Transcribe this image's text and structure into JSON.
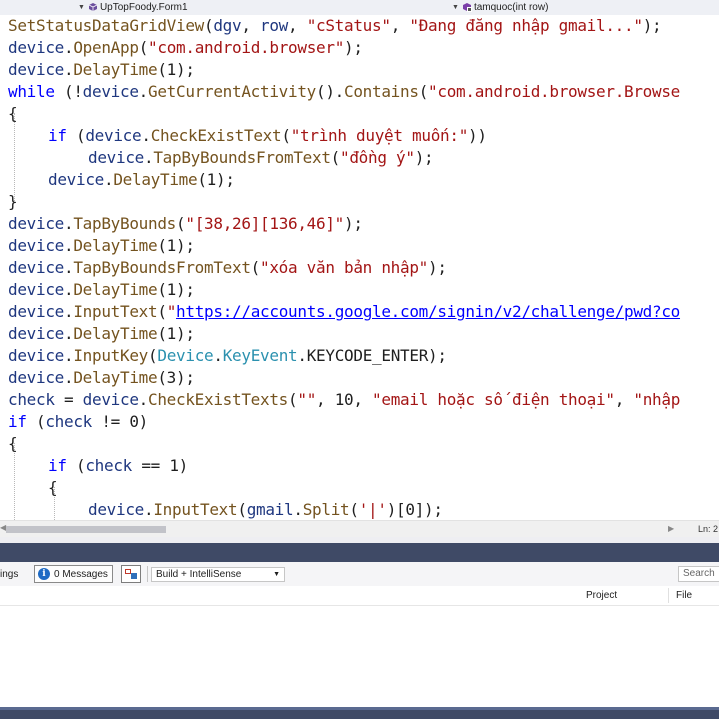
{
  "navbar": {
    "class_dropdown": "UpTopFoody.Form1",
    "member_dropdown": "tamquoc(int row)"
  },
  "editor": {
    "lines": [
      {
        "indent": 0,
        "tokens": [
          {
            "t": "SetStatusDataGridView",
            "c": "fn"
          },
          {
            "t": "(",
            "c": "plain"
          },
          {
            "t": "dgv",
            "c": "id"
          },
          {
            "t": ", ",
            "c": "plain"
          },
          {
            "t": "row",
            "c": "id"
          },
          {
            "t": ", ",
            "c": "plain"
          },
          {
            "t": "\"cStatus\"",
            "c": "str"
          },
          {
            "t": ", ",
            "c": "plain"
          },
          {
            "t": "\"Đang đăng nhập gmail...\"",
            "c": "str"
          },
          {
            "t": ");",
            "c": "plain"
          }
        ]
      },
      {
        "indent": 0,
        "tokens": [
          {
            "t": "device",
            "c": "id"
          },
          {
            "t": ".",
            "c": "plain"
          },
          {
            "t": "OpenApp",
            "c": "fn"
          },
          {
            "t": "(",
            "c": "plain"
          },
          {
            "t": "\"com.android.browser\"",
            "c": "str"
          },
          {
            "t": ");",
            "c": "plain"
          }
        ]
      },
      {
        "indent": 0,
        "tokens": [
          {
            "t": "device",
            "c": "id"
          },
          {
            "t": ".",
            "c": "plain"
          },
          {
            "t": "DelayTime",
            "c": "fn"
          },
          {
            "t": "(1);",
            "c": "plain"
          }
        ]
      },
      {
        "indent": 0,
        "tokens": [
          {
            "t": "while",
            "c": "kw"
          },
          {
            "t": " (!",
            "c": "plain"
          },
          {
            "t": "device",
            "c": "id"
          },
          {
            "t": ".",
            "c": "plain"
          },
          {
            "t": "GetCurrentActivity",
            "c": "fn"
          },
          {
            "t": "().",
            "c": "plain"
          },
          {
            "t": "Contains",
            "c": "fn"
          },
          {
            "t": "(",
            "c": "plain"
          },
          {
            "t": "\"com.android.browser.Browse",
            "c": "str"
          }
        ]
      },
      {
        "indent": 0,
        "tokens": [
          {
            "t": "{",
            "c": "plain"
          }
        ]
      },
      {
        "indent": 1,
        "tokens": [
          {
            "t": "if",
            "c": "kw"
          },
          {
            "t": " (",
            "c": "plain"
          },
          {
            "t": "device",
            "c": "id"
          },
          {
            "t": ".",
            "c": "plain"
          },
          {
            "t": "CheckExistText",
            "c": "fn"
          },
          {
            "t": "(",
            "c": "plain"
          },
          {
            "t": "\"trình duyệt muốn:\"",
            "c": "str"
          },
          {
            "t": "))",
            "c": "plain"
          }
        ]
      },
      {
        "indent": 2,
        "tokens": [
          {
            "t": "device",
            "c": "id"
          },
          {
            "t": ".",
            "c": "plain"
          },
          {
            "t": "TapByBoundsFromText",
            "c": "fn"
          },
          {
            "t": "(",
            "c": "plain"
          },
          {
            "t": "\"đồng ý\"",
            "c": "str"
          },
          {
            "t": ");",
            "c": "plain"
          }
        ]
      },
      {
        "indent": 1,
        "tokens": [
          {
            "t": "device",
            "c": "id"
          },
          {
            "t": ".",
            "c": "plain"
          },
          {
            "t": "DelayTime",
            "c": "fn"
          },
          {
            "t": "(1);",
            "c": "plain"
          }
        ]
      },
      {
        "indent": 0,
        "tokens": [
          {
            "t": "}",
            "c": "plain"
          }
        ]
      },
      {
        "indent": 0,
        "tokens": [
          {
            "t": "device",
            "c": "id"
          },
          {
            "t": ".",
            "c": "plain"
          },
          {
            "t": "TapByBounds",
            "c": "fn"
          },
          {
            "t": "(",
            "c": "plain"
          },
          {
            "t": "\"[38,26][136,46]\"",
            "c": "str"
          },
          {
            "t": ");",
            "c": "plain"
          }
        ]
      },
      {
        "indent": 0,
        "tokens": [
          {
            "t": "device",
            "c": "id"
          },
          {
            "t": ".",
            "c": "plain"
          },
          {
            "t": "DelayTime",
            "c": "fn"
          },
          {
            "t": "(1);",
            "c": "plain"
          }
        ]
      },
      {
        "indent": 0,
        "tokens": [
          {
            "t": "device",
            "c": "id"
          },
          {
            "t": ".",
            "c": "plain"
          },
          {
            "t": "TapByBoundsFromText",
            "c": "fn"
          },
          {
            "t": "(",
            "c": "plain"
          },
          {
            "t": "\"xóa văn bản nhập\"",
            "c": "str"
          },
          {
            "t": ");",
            "c": "plain"
          }
        ]
      },
      {
        "indent": 0,
        "tokens": [
          {
            "t": "device",
            "c": "id"
          },
          {
            "t": ".",
            "c": "plain"
          },
          {
            "t": "DelayTime",
            "c": "fn"
          },
          {
            "t": "(1);",
            "c": "plain"
          }
        ]
      },
      {
        "indent": 0,
        "tokens": [
          {
            "t": "device",
            "c": "id"
          },
          {
            "t": ".",
            "c": "plain"
          },
          {
            "t": "InputText",
            "c": "fn"
          },
          {
            "t": "(",
            "c": "plain"
          },
          {
            "t": "\"",
            "c": "str"
          },
          {
            "t": "https://accounts.google.com/signin/v2/challenge/pwd?co",
            "c": "url"
          }
        ]
      },
      {
        "indent": 0,
        "tokens": [
          {
            "t": "device",
            "c": "id"
          },
          {
            "t": ".",
            "c": "plain"
          },
          {
            "t": "DelayTime",
            "c": "fn"
          },
          {
            "t": "(1);",
            "c": "plain"
          }
        ]
      },
      {
        "indent": 0,
        "tokens": [
          {
            "t": "device",
            "c": "id"
          },
          {
            "t": ".",
            "c": "plain"
          },
          {
            "t": "InputKey",
            "c": "fn"
          },
          {
            "t": "(",
            "c": "plain"
          },
          {
            "t": "Device",
            "c": "type"
          },
          {
            "t": ".",
            "c": "plain"
          },
          {
            "t": "KeyEvent",
            "c": "type"
          },
          {
            "t": ".KEYCODE_ENTER);",
            "c": "plain"
          }
        ]
      },
      {
        "indent": 0,
        "tokens": [
          {
            "t": "device",
            "c": "id"
          },
          {
            "t": ".",
            "c": "plain"
          },
          {
            "t": "DelayTime",
            "c": "fn"
          },
          {
            "t": "(3);",
            "c": "plain"
          }
        ]
      },
      {
        "indent": 0,
        "tokens": [
          {
            "t": "check",
            "c": "id"
          },
          {
            "t": " = ",
            "c": "plain"
          },
          {
            "t": "device",
            "c": "id"
          },
          {
            "t": ".",
            "c": "plain"
          },
          {
            "t": "CheckExistTexts",
            "c": "fn"
          },
          {
            "t": "(",
            "c": "plain"
          },
          {
            "t": "\"\"",
            "c": "str"
          },
          {
            "t": ", 10, ",
            "c": "plain"
          },
          {
            "t": "\"email hoặc số điện thoại\"",
            "c": "str"
          },
          {
            "t": ", ",
            "c": "plain"
          },
          {
            "t": "\"nhập",
            "c": "str"
          }
        ]
      },
      {
        "indent": 0,
        "tokens": [
          {
            "t": "if",
            "c": "kw"
          },
          {
            "t": " (",
            "c": "plain"
          },
          {
            "t": "check",
            "c": "id"
          },
          {
            "t": " != 0)",
            "c": "plain"
          }
        ]
      },
      {
        "indent": 0,
        "tokens": [
          {
            "t": "{",
            "c": "plain"
          }
        ]
      },
      {
        "indent": 1,
        "tokens": [
          {
            "t": "if",
            "c": "kw"
          },
          {
            "t": " (",
            "c": "plain"
          },
          {
            "t": "check",
            "c": "id"
          },
          {
            "t": " == 1)",
            "c": "plain"
          }
        ]
      },
      {
        "indent": 1,
        "tokens": [
          {
            "t": "{",
            "c": "plain"
          }
        ]
      },
      {
        "indent": 2,
        "tokens": [
          {
            "t": "device",
            "c": "id"
          },
          {
            "t": ".",
            "c": "plain"
          },
          {
            "t": "InputText",
            "c": "fn"
          },
          {
            "t": "(",
            "c": "plain"
          },
          {
            "t": "gmail",
            "c": "id"
          },
          {
            "t": ".",
            "c": "plain"
          },
          {
            "t": "Split",
            "c": "fn"
          },
          {
            "t": "(",
            "c": "plain"
          },
          {
            "t": "'|'",
            "c": "str"
          },
          {
            "t": ")[0]);",
            "c": "plain"
          }
        ]
      }
    ]
  },
  "scrollbar": {
    "line_indicator": "Ln: 2"
  },
  "error_list": {
    "warnings_label": "ings",
    "messages_label": "0 Messages",
    "build_filter": "Build + IntelliSense",
    "search_placeholder": "Search",
    "columns": [
      "Project",
      "File"
    ]
  }
}
